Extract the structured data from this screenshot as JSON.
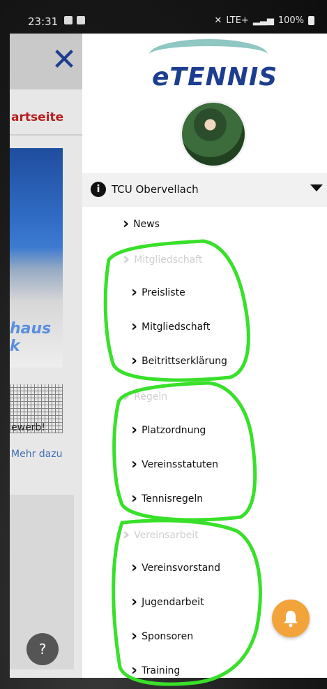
{
  "statusbar": {
    "time": "23:31",
    "network": "LTE+",
    "battery": "100%"
  },
  "underlay": {
    "start_label": "artseite",
    "photo_text": "haus k",
    "card_text": "ewerb!",
    "more_link": "Mehr dazu",
    "help_icon": "?"
  },
  "drawer": {
    "logo": "eTENNIS",
    "club": {
      "info_icon": "i",
      "name": "TCU Obervellach"
    },
    "menu": {
      "news": "News",
      "sec1": "Mitgliedschaft",
      "preisliste": "Preisliste",
      "mitgliedschaft": "Mitgliedschaft",
      "beitritt": "Beitrittserklärung",
      "sec2": "Regeln",
      "platzordnung": "Platzordnung",
      "statuten": "Vereinsstatuten",
      "tennisregeln": "Tennisregeln",
      "sec3": "Vereinsarbeit",
      "vorstand": "Vereinsvorstand",
      "jugend": "Jugendarbeit",
      "sponsoren": "Sponsoren",
      "training": "Training"
    }
  },
  "colors": {
    "brand": "#1d3d8f",
    "accent_red": "#b71c1c",
    "bell_orange": "#f2a33a",
    "annotation_green": "#39e02a"
  }
}
